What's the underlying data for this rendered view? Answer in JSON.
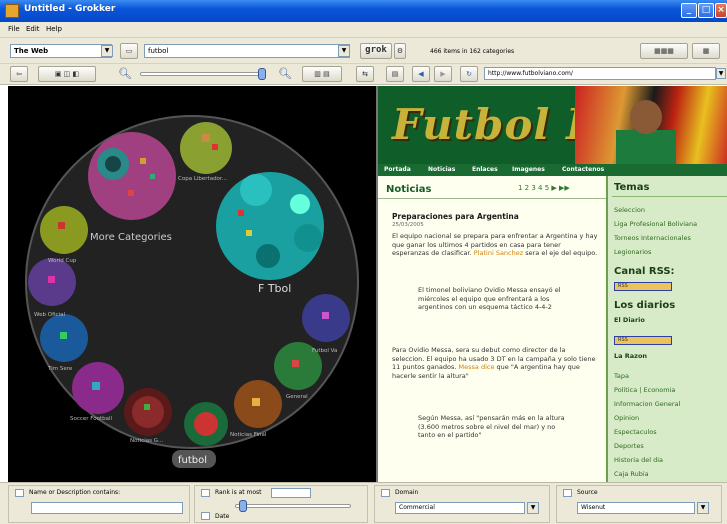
{
  "window": {
    "title": "Untitled - Grokker",
    "min": "_",
    "max": "□",
    "close": "×"
  },
  "menu": [
    "File",
    "Edit",
    "Help"
  ],
  "toolbar": {
    "source_select": "The Web",
    "query_value": "futbol",
    "grok_label": "grok",
    "result_count": "466 items in 162 categories"
  },
  "navbar": {
    "url": "http://www.futbolviano.com/"
  },
  "viz": {
    "labels": {
      "more_categories": "More Categories",
      "ftbol": "F Tbol",
      "copa": "Copa Libertador...",
      "world_cup": "World Cup",
      "web_oficial": "Web Oficial",
      "tim_sere": "Tim Sere",
      "soccer_football": "Soccer Football",
      "noticias": "Noticias G...",
      "noticias_final": "Noticias Final",
      "general": "General",
      "futbol_va": "Futbol Va",
      "center": "futbol"
    }
  },
  "page": {
    "logo": "Futbol B",
    "nav": [
      "Portada",
      "Noticias",
      "Enlaces",
      "Imagenes",
      "Contactenos"
    ],
    "section": "Noticias",
    "pages": "1 2 3 4 5 ▶ ▶▶",
    "article_title": "Preparaciones para Argentina",
    "article_date": "25/03/2005",
    "p1": "El equipo nacional se prepara para enfrentar a Argentina y hay que ganar los ultimos 4 partidos en casa para tener esperanzas de clasificar.",
    "p1_link": "Platini Sanchez",
    "p1_tail": "sera el eje del equipo.",
    "quote1": "El timonel boliviano Ovidio Messa ensayó el miércoles el equipo que enfrentará a los argentinos con un esquema táctico 4-4-2",
    "p2": "Para Ovidio Messa, sera su debut como director de la seleccion. El equipo ha usado 3 DT en la campaña y solo tiene 11 puntos ganados.",
    "p2_link": "Messa dice",
    "p2_tail": "que \"A argentina hay que hacerle sentir la altura\"",
    "quote2": "Según Messa, así \"pensarán más en la altura (3.600 metros sobre el nivel del mar) y no tanto en el partido\"",
    "sidebar": {
      "temas": "Temas",
      "temas_items": [
        "Seleccion",
        "Liga Profesional Boliviana",
        "Torneos Internacionales",
        "Legionarios"
      ],
      "canal": "Canal RSS:",
      "rss_btn": "RSS",
      "diarios": "Los diarios",
      "diario1": "El Diario",
      "rss_btn2": "RSS",
      "diario2": "La Razon",
      "diario_items": [
        "Tapa",
        "Politica | Economia",
        "Informacion General",
        "Opinion",
        "Espectaculos",
        "Deportes",
        "Historia del dia",
        "Caja Rubia"
      ]
    }
  },
  "filters": {
    "name_label": "Name or Description contains:",
    "rank_label": "Rank is at most",
    "rank_value": "",
    "date_label": "Date",
    "domain_label": "Domain",
    "domain_value": "Commercial",
    "source_label": "Source",
    "source_value": "Wisenut"
  }
}
